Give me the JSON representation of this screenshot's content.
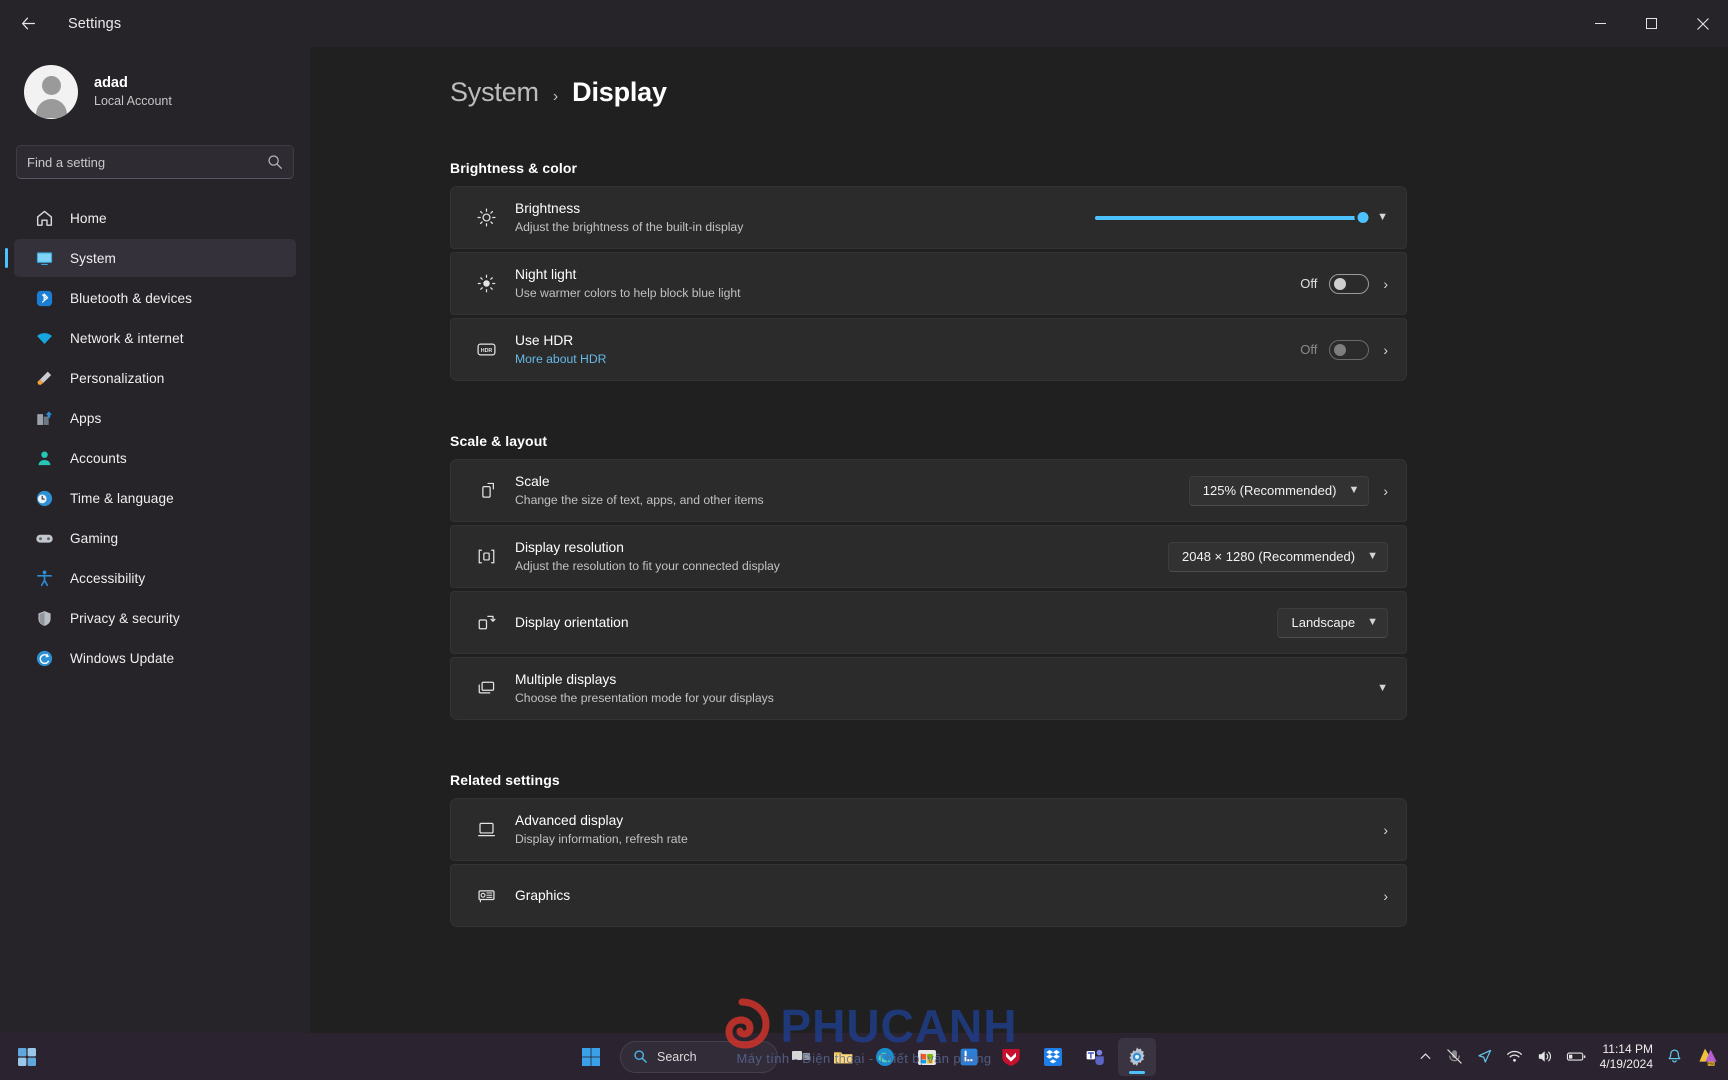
{
  "window": {
    "title": "Settings",
    "back_icon": "back-arrow-icon",
    "minimize": "─",
    "maximize": "❐",
    "close": "✕"
  },
  "sidebar": {
    "account": {
      "name": "adad",
      "subtitle": "Local Account"
    },
    "search": {
      "placeholder": "Find a setting",
      "value": ""
    },
    "items": [
      {
        "label": "Home",
        "icon": "home-icon",
        "active": false
      },
      {
        "label": "System",
        "icon": "system-icon",
        "active": true
      },
      {
        "label": "Bluetooth & devices",
        "icon": "bluetooth-icon",
        "active": false
      },
      {
        "label": "Network & internet",
        "icon": "wifi-icon",
        "active": false
      },
      {
        "label": "Personalization",
        "icon": "brush-icon",
        "active": false
      },
      {
        "label": "Apps",
        "icon": "apps-icon",
        "active": false
      },
      {
        "label": "Accounts",
        "icon": "account-icon",
        "active": false
      },
      {
        "label": "Time & language",
        "icon": "clock-globe-icon",
        "active": false
      },
      {
        "label": "Gaming",
        "icon": "gamepad-icon",
        "active": false
      },
      {
        "label": "Accessibility",
        "icon": "accessibility-icon",
        "active": false
      },
      {
        "label": "Privacy & security",
        "icon": "shield-icon",
        "active": false
      },
      {
        "label": "Windows Update",
        "icon": "update-icon",
        "active": false
      }
    ]
  },
  "breadcrumb": {
    "parent": "System",
    "separator": "›",
    "current": "Display"
  },
  "sections": [
    {
      "title": "Brightness & color",
      "rows": [
        {
          "title": "Brightness",
          "subtitle": "Adjust the brightness of the built-in display",
          "icon": "brightness-icon",
          "control": "slider",
          "slider_percent": 100,
          "expand_icon": "chevron-down-icon"
        },
        {
          "title": "Night light",
          "subtitle": "Use warmer colors to help block blue light",
          "icon": "night-light-icon",
          "control": "toggle",
          "toggle_state": "Off",
          "disabled": false,
          "chevron": "chevron-right-icon"
        },
        {
          "title": "Use HDR",
          "link": "More about HDR",
          "icon": "hdr-icon",
          "control": "toggle",
          "toggle_state": "Off",
          "disabled": true,
          "chevron": "chevron-right-icon"
        }
      ]
    },
    {
      "title": "Scale & layout",
      "rows": [
        {
          "title": "Scale",
          "subtitle": "Change the size of text, apps, and other items",
          "icon": "scale-icon",
          "control": "dropdown",
          "value": "125% (Recommended)",
          "chevron": "chevron-right-icon"
        },
        {
          "title": "Display resolution",
          "subtitle": "Adjust the resolution to fit your connected display",
          "icon": "resolution-icon",
          "control": "dropdown",
          "value": "2048 × 1280 (Recommended)"
        },
        {
          "title": "Display orientation",
          "subtitle": "",
          "icon": "orientation-icon",
          "control": "dropdown",
          "value": "Landscape"
        },
        {
          "title": "Multiple displays",
          "subtitle": "Choose the presentation mode for your displays",
          "icon": "multiple-displays-icon",
          "control": "expand",
          "expand_icon": "chevron-down-icon"
        }
      ]
    },
    {
      "title": "Related settings",
      "rows": [
        {
          "title": "Advanced display",
          "subtitle": "Display information, refresh rate",
          "icon": "monitor-icon",
          "control": "link",
          "chevron": "chevron-right-icon"
        },
        {
          "title": "Graphics",
          "subtitle": "",
          "icon": "graphics-card-icon",
          "control": "link",
          "chevron": "chevron-right-icon"
        }
      ]
    }
  ],
  "taskbar": {
    "start_icon": "windows-start-icon",
    "search": {
      "label": "Search",
      "icon": "search-icon"
    },
    "apps": [
      {
        "icon": "task-view-icon",
        "active": false
      },
      {
        "icon": "file-explorer-icon",
        "active": false
      },
      {
        "icon": "edge-icon",
        "active": false
      },
      {
        "icon": "microsoft-store-icon",
        "active": false
      },
      {
        "icon": "lastpass-icon",
        "active": false
      },
      {
        "icon": "mcafee-icon",
        "active": false
      },
      {
        "icon": "dropbox-icon",
        "active": false
      },
      {
        "icon": "teams-icon",
        "active": false
      },
      {
        "icon": "settings-gear-icon",
        "active": true
      }
    ],
    "tray": [
      {
        "icon": "chevron-up-icon"
      },
      {
        "icon": "microphone-muted-icon"
      },
      {
        "icon": "location-icon"
      },
      {
        "icon": "wifi-icon"
      },
      {
        "icon": "volume-icon"
      },
      {
        "icon": "battery-icon"
      }
    ],
    "clock": {
      "time": "11:14 PM",
      "date": "4/19/2024"
    },
    "notification_icon": "bell-icon",
    "copilot_icon": "copilot-icon"
  },
  "watermark": {
    "text": "PHUCANH",
    "tagline": "Máy tính - Điện thoại - Thiết bị văn phòng"
  },
  "colors": {
    "accent": "#4cc2ff",
    "sidebar_bg": "#272429",
    "content_bg": "#202020",
    "card_bg": "#2b2b2b",
    "taskbar_bg": "#2b2430"
  }
}
